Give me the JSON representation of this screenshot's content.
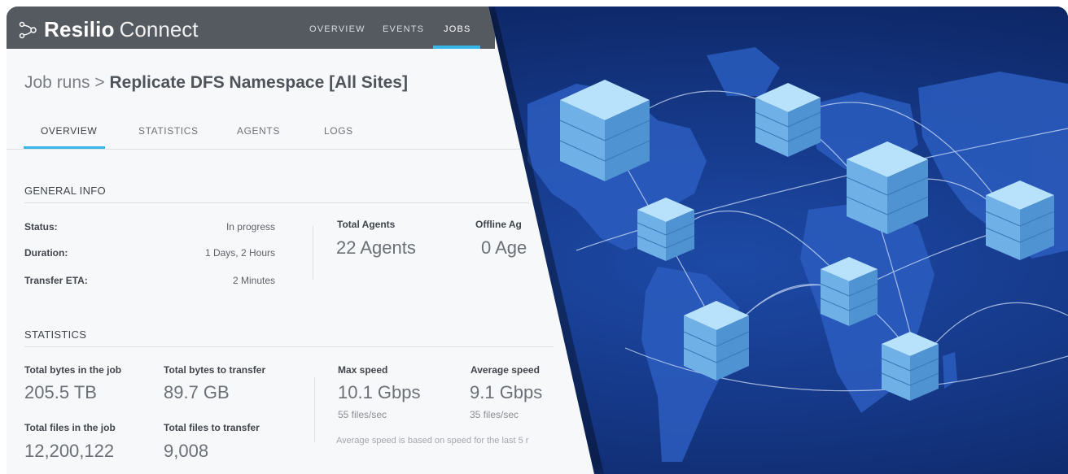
{
  "app": {
    "brand_strong": "Resilio",
    "brand_light": "Connect"
  },
  "nav": {
    "overview": "OVERVIEW",
    "events": "EVENTS",
    "jobs": "JOBS"
  },
  "breadcrumb": {
    "parent": "Job runs",
    "separator": ">",
    "current": "Replicate DFS Namespace [All Sites]"
  },
  "tabs": [
    "OVERVIEW",
    "STATISTICS",
    "AGENTS",
    "LOGS"
  ],
  "general_info": {
    "title": "GENERAL INFO",
    "status_label": "Status:",
    "status_value": "In progress",
    "duration_label": "Duration:",
    "duration_value": "1 Days, 2 Hours",
    "eta_label": "Transfer ETA:",
    "eta_value": "2 Minutes",
    "total_agents_label": "Total Agents",
    "total_agents_value": "22 Agents",
    "offline_agents_label": "Offline Ag",
    "offline_agents_value": "0 Age"
  },
  "statistics": {
    "title": "STATISTICS",
    "total_bytes_label": "Total bytes in the job",
    "total_bytes_value": "205.5 TB",
    "bytes_transfer_label": "Total bytes to transfer",
    "bytes_transfer_value": "89.7 GB",
    "total_files_label": "Total files in the job",
    "total_files_value": "12,200,122",
    "files_transfer_label": "Total files to transfer",
    "files_transfer_value": "9,008",
    "max_speed_label": "Max speed",
    "max_speed_value": "10.1 Gbps",
    "max_speed_files": "55 files/sec",
    "avg_speed_label": "Average speed",
    "avg_speed_value": "9.1 Gbps",
    "avg_speed_files": "35 files/sec",
    "note": "Average speed is based on speed for the last 5 r"
  },
  "colors": {
    "topbar": "#555a61",
    "accent": "#38b6e8",
    "map_bg": "#163a8b",
    "server": "#8cc8ee"
  }
}
